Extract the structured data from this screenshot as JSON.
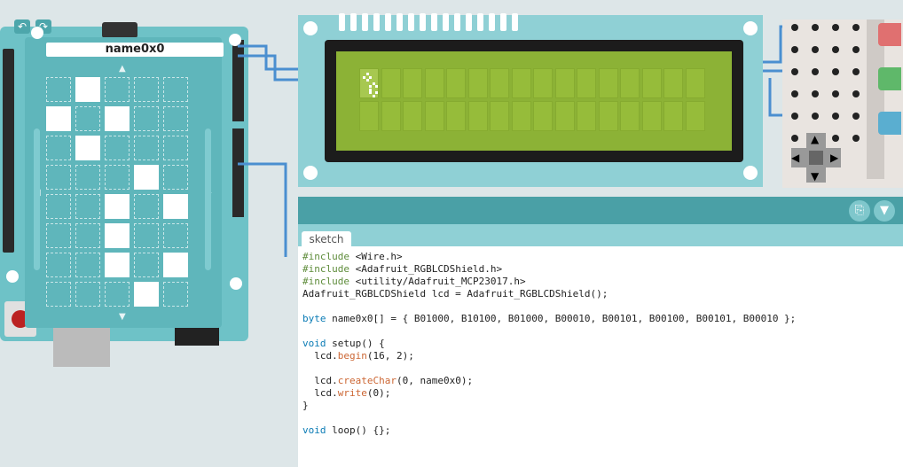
{
  "shield": {
    "name": "name0x0",
    "pixels": [
      [
        0,
        1,
        0,
        0,
        0
      ],
      [
        1,
        0,
        1,
        0,
        0
      ],
      [
        0,
        1,
        0,
        0,
        0
      ],
      [
        0,
        0,
        0,
        1,
        0
      ],
      [
        0,
        0,
        1,
        0,
        1
      ],
      [
        0,
        0,
        1,
        0,
        0
      ],
      [
        0,
        0,
        1,
        0,
        1
      ],
      [
        0,
        0,
        0,
        1,
        0
      ]
    ]
  },
  "lcd": {
    "columns": 16,
    "rows": 2
  },
  "editor": {
    "tab": "sketch",
    "lines": [
      "#include <Wire.h>",
      "#include <Adafruit_RGBLCDShield.h>",
      "#include <utility/Adafruit_MCP23017.h>",
      "Adafruit_RGBLCDShield lcd = Adafruit_RGBLCDShield();",
      "",
      "byte name0x0[] = { B01000, B10100, B01000, B00010, B00101, B00100, B00101, B00010 };",
      "",
      "void setup() {",
      "  lcd.begin(16, 2);",
      "",
      "  lcd.createChar(0, name0x0);",
      "  lcd.write(0);",
      "}",
      "",
      "void loop() {};"
    ]
  },
  "colors": {
    "accent": "#4aa0a6",
    "lcd": "#8cb236",
    "wire": "#4a8fd0"
  }
}
